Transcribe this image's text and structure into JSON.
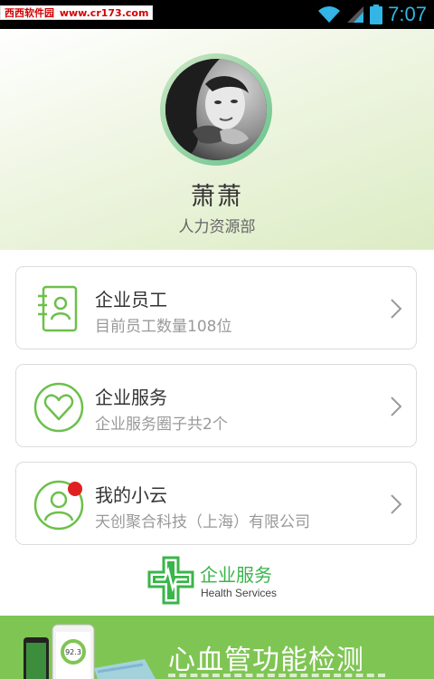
{
  "status_bar": {
    "watermark_cn": "西西软件园",
    "watermark_site": "www.cr173.com",
    "time": "7:07"
  },
  "profile": {
    "name": "萧萧",
    "department": "人力资源部"
  },
  "menu": [
    {
      "title": "企业员工",
      "subtitle": "目前员工数量108位",
      "icon": "contacts-icon"
    },
    {
      "title": "企业服务",
      "subtitle": "企业服务圈子共2个",
      "icon": "heart-icon"
    },
    {
      "title": "我的小云",
      "subtitle": "天创聚合科技（上海）有限公司",
      "icon": "user-icon",
      "has_badge": true
    }
  ],
  "brand": {
    "name_cn": "企业服务",
    "name_en": "Health Services"
  },
  "banner": {
    "title": "心血管功能检测",
    "device_reading": "92.3"
  },
  "colors": {
    "accent_green": "#6cc04a",
    "badge_red": "#e02020",
    "banner_green": "#7fc553",
    "time_blue": "#33b5e5"
  }
}
